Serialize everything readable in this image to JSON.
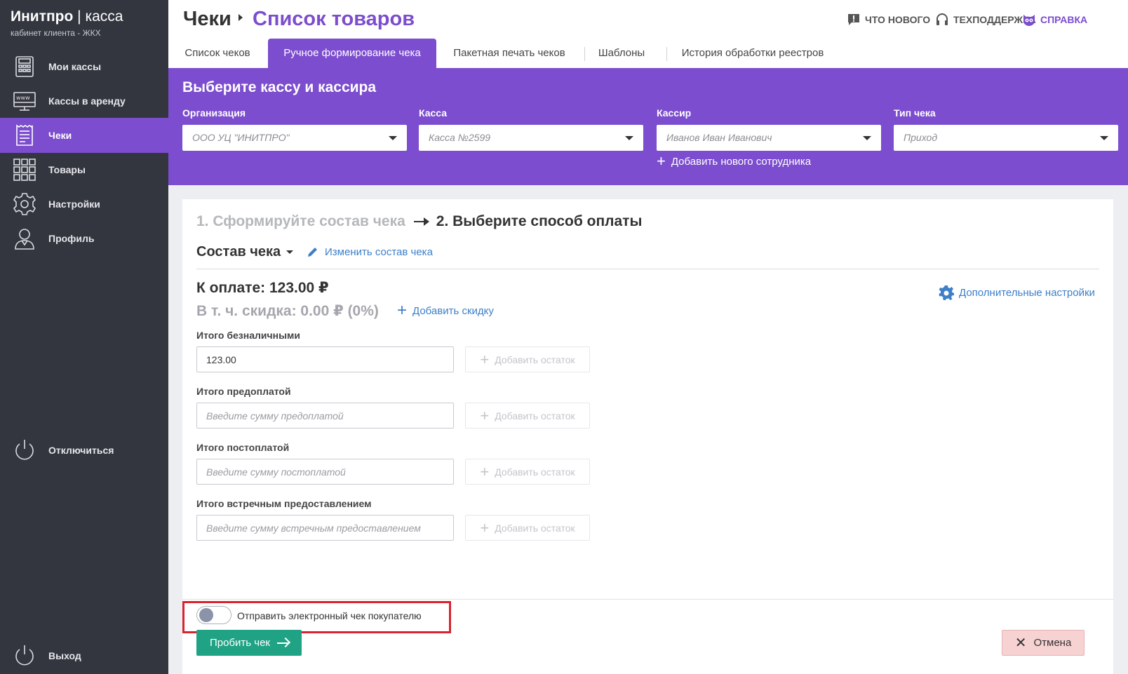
{
  "brand": {
    "name": "Инитпро",
    "separator": "|",
    "product": "касса",
    "subtitle": "кабинет клиента - ЖКХ"
  },
  "sidebar": {
    "items": [
      {
        "label": "Мои кассы",
        "icon": "cash-register-icon"
      },
      {
        "label": "Кассы в аренду",
        "icon": "www-monitor-icon"
      },
      {
        "label": "Чеки",
        "icon": "receipt-icon",
        "active": true
      },
      {
        "label": "Товары",
        "icon": "grid-icon"
      },
      {
        "label": "Настройки",
        "icon": "gear-icon"
      },
      {
        "label": "Профиль",
        "icon": "user-icon"
      }
    ],
    "disconnect": "Отключиться",
    "logout": "Выход"
  },
  "header": {
    "crumb_root": "Чеки",
    "crumb_current": "Список товаров",
    "links": {
      "whats_new": "ЧТО НОВОГО",
      "support": "ТЕХПОДДЕРЖКА",
      "help": "СПРАВКА"
    }
  },
  "tabs": [
    "Список чеков",
    "Ручное формирование чека",
    "Пакетная печать чеков",
    "Шаблоны",
    "История обработки реестров"
  ],
  "panel": {
    "title": "Выберите кассу и кассира",
    "fields": [
      {
        "label": "Организация",
        "value": "ООО УЦ \"ИНИТПРО\""
      },
      {
        "label": "Касса",
        "value": "Касса №2599"
      },
      {
        "label": "Кассир",
        "value": "Иванов Иван Иванович"
      },
      {
        "label": "Тип чека",
        "value": "Приход"
      }
    ],
    "add_employee": "Добавить нового сотрудника"
  },
  "steps": {
    "step1": "1. Сформируйте состав чека",
    "step2": "2. Выберите способ оплаты"
  },
  "composition": {
    "title": "Состав чека",
    "edit": "Изменить состав чека"
  },
  "summary": {
    "to_pay": "К оплате: 123.00 ₽",
    "discount": "В т. ч. скидка: 0.00 ₽ (0%)",
    "add_discount": "Добавить скидку",
    "extra_settings": "Дополнительные настройки"
  },
  "payments": [
    {
      "label": "Итого безналичными",
      "value": "123.00",
      "placeholder": ""
    },
    {
      "label": "Итого предоплатой",
      "value": "",
      "placeholder": "Введите сумму предоплатой"
    },
    {
      "label": "Итого постоплатой",
      "value": "",
      "placeholder": "Введите сумму постоплатой"
    },
    {
      "label": "Итого встречным предоставлением",
      "value": "",
      "placeholder": "Введите сумму встречным предоставлением"
    }
  ],
  "add_rest": "Добавить остаток",
  "footer": {
    "send_receipt": "Отправить электронный чек покупателю",
    "submit": "Пробить чек",
    "cancel": "Отмена"
  },
  "colors": {
    "accent": "#7c4dce",
    "sidebar": "#33363f",
    "link": "#3d7fc8",
    "submit": "#1fa384",
    "highlight": "#d9232e"
  }
}
